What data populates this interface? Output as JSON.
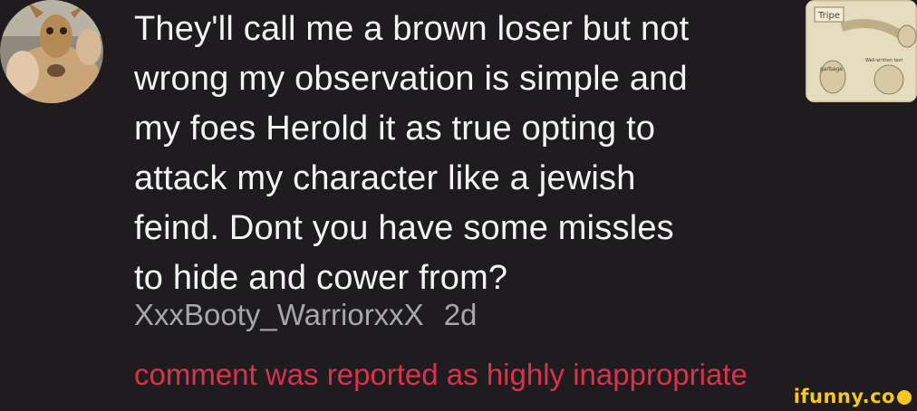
{
  "comment": {
    "text_lines": [
      "They'll call me a brown loser but not",
      "wrong my observation is simple and",
      "my foes Herold it as true opting to",
      "attack my character like a jewish",
      "feind. Dont you have some missles",
      "to hide and cower from?"
    ],
    "username": "XxxBooty_WarriorxxX",
    "time": "2d",
    "report_notice": "comment was reported as highly inappropriate"
  },
  "thumbnail": {
    "label_top": "Tripe",
    "label_bottom": "garbage",
    "label_side": "Well-written text"
  },
  "watermark": {
    "text": "ifunny.co"
  },
  "colors": {
    "background": "#1f1c20",
    "text": "#f4f4f4",
    "meta": "#a7a6a9",
    "report": "#d8334c",
    "watermark": "#f6c81b"
  }
}
